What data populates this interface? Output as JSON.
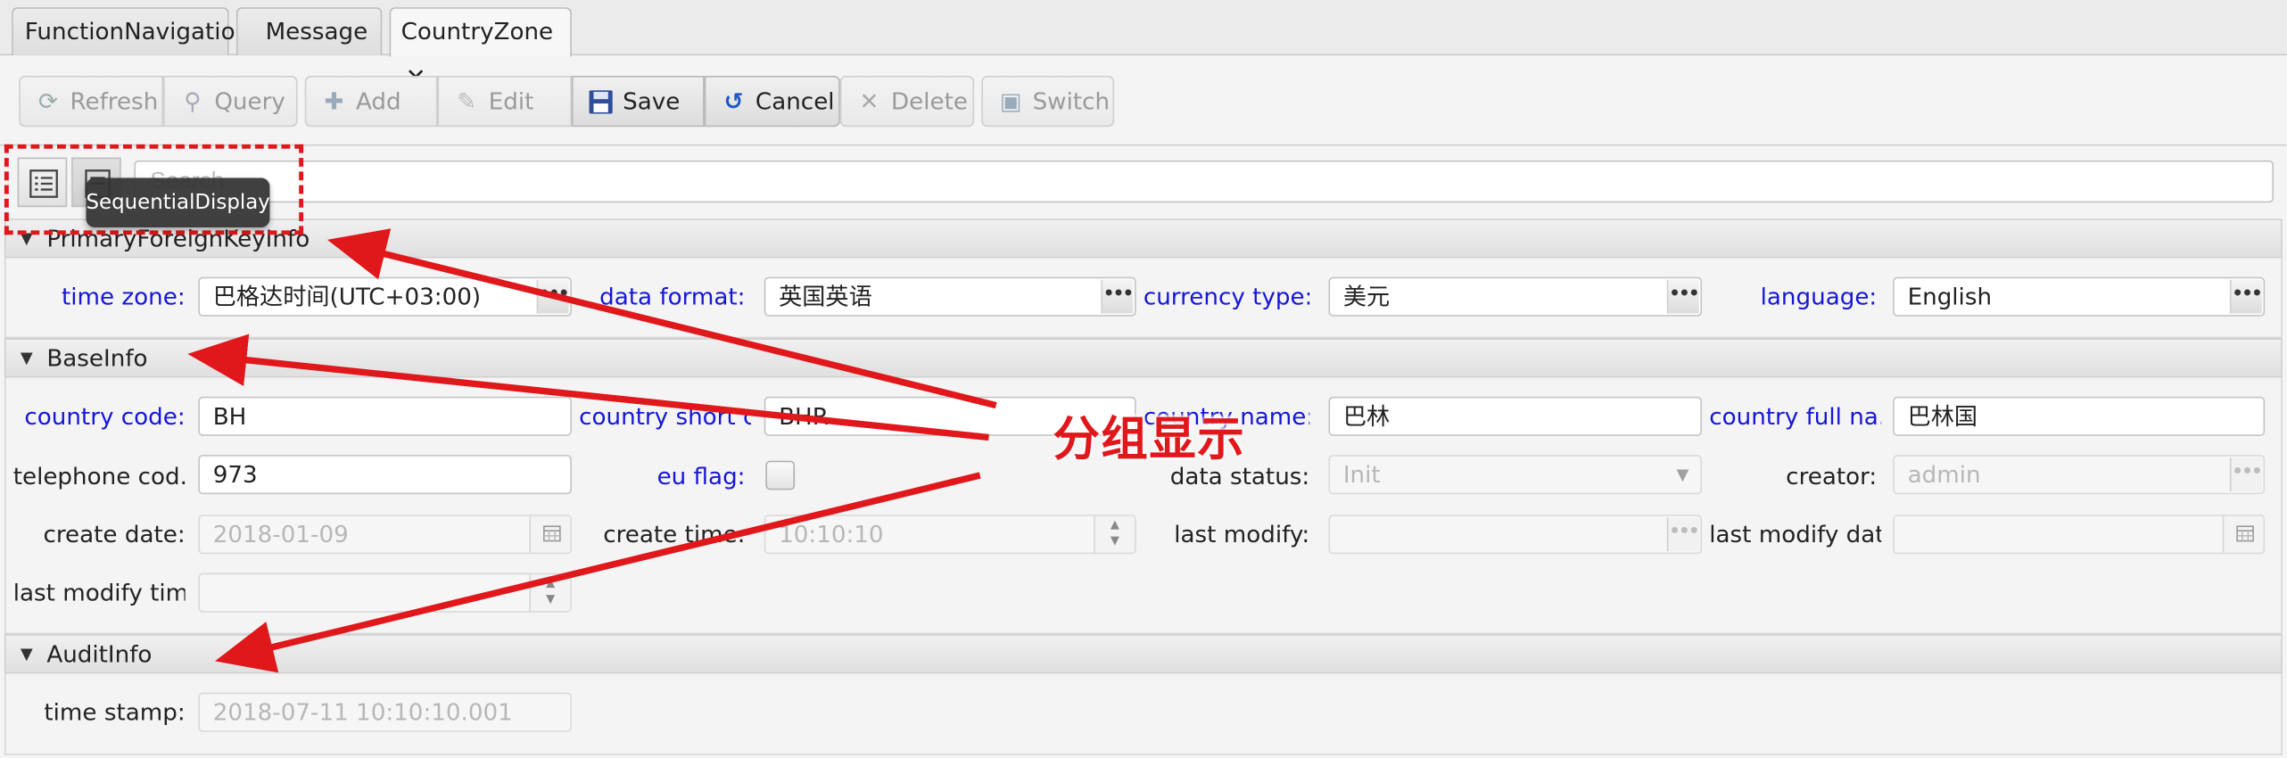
{
  "tabs": [
    {
      "label": "FunctionNavigation"
    },
    {
      "label": "Message"
    },
    {
      "label": "CountryZone",
      "close": "✕"
    }
  ],
  "toolbar": {
    "refresh": "Refresh",
    "query": "Query",
    "add": "Add",
    "edit": "Edit",
    "save": "Save",
    "cancel": "Cancel",
    "delete": "Delete",
    "switch": "Switch"
  },
  "search": {
    "placeholder": "Search"
  },
  "tooltip": "SequentialDisplay",
  "sections": {
    "primary": "PrimaryForeignKeyInfo",
    "base": "BaseInfo",
    "audit": "AuditInfo"
  },
  "primary": {
    "time_zone_label": "time zone:",
    "time_zone": "巴格达时间(UTC+03:00)",
    "data_format_label": "data format:",
    "data_format": "英国英语",
    "currency_label": "currency type:",
    "currency": "美元",
    "language_label": "language:",
    "language": "English"
  },
  "base": {
    "country_code_label": "country code:",
    "country_code": "BH",
    "country_short_label": "country short c...",
    "country_short": "BHR",
    "country_name_label": "country name:",
    "country_name": "巴林",
    "country_full_label": "country full na...",
    "country_full": "巴林国",
    "telephone_label": "telephone cod...",
    "telephone": "973",
    "eu_flag_label": "eu flag:",
    "data_status_label": "data status:",
    "data_status": "Init",
    "creator_label": "creator:",
    "creator": "admin",
    "create_date_label": "create date:",
    "create_date": "2018-01-09",
    "create_time_label": "create time:",
    "create_time": "10:10:10",
    "last_modify_label": "last modify:",
    "last_modify": "",
    "last_modify_date_label": "last modify dat...",
    "last_modify_date": "",
    "last_modify_time_label": "last modify tim...",
    "last_modify_time": ""
  },
  "audit": {
    "time_stamp_label": "time stamp:",
    "time_stamp": "2018-07-11 10:10:10.001"
  },
  "annotation": "分组显示",
  "colors": {
    "required_label": "#1616d8",
    "annotation": "#e0171b"
  }
}
